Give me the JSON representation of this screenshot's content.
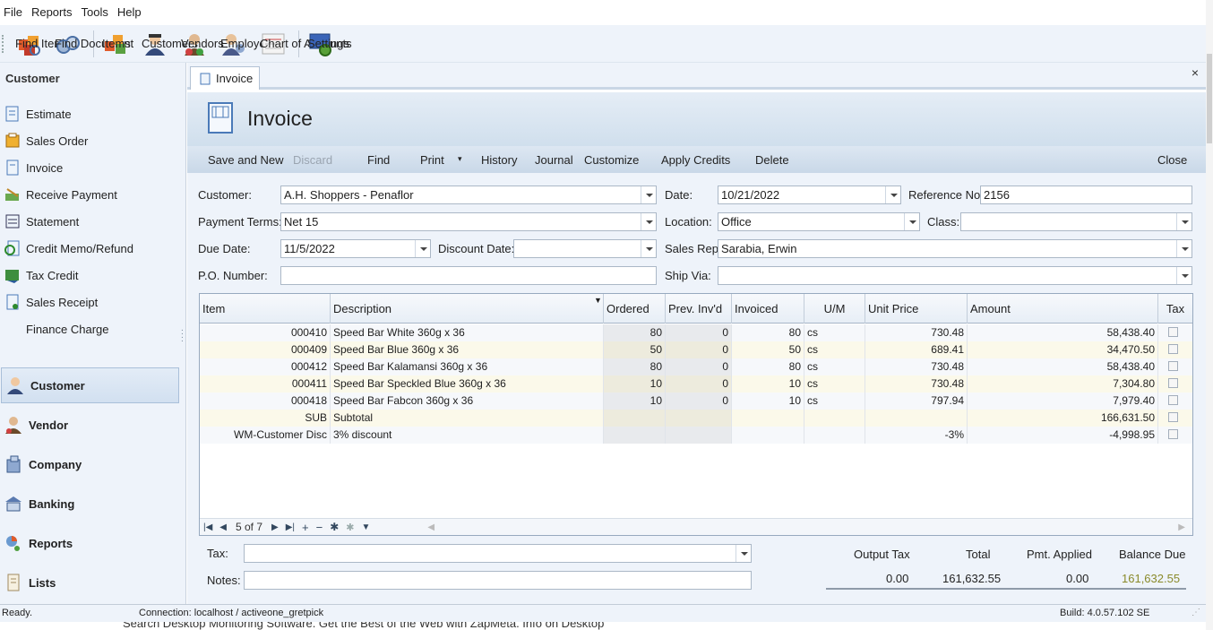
{
  "menu": {
    "items": [
      "File",
      "Reports",
      "Tools",
      "Help"
    ]
  },
  "toolbar": {
    "buttons": [
      {
        "label": "Find Item",
        "icon": "find-item-icon"
      },
      {
        "label": "Find Document",
        "icon": "find-document-icon"
      },
      {
        "label": "Items",
        "icon": "items-icon"
      },
      {
        "label": "Customers",
        "icon": "customers-icon"
      },
      {
        "label": "Vendors",
        "icon": "vendors-icon"
      },
      {
        "label": "Employees",
        "icon": "employees-icon"
      },
      {
        "label": "Chart of Accounts",
        "icon": "chart-of-accounts-icon"
      },
      {
        "label": "Settings",
        "icon": "settings-icon"
      }
    ]
  },
  "sidebar": {
    "header": "Customer",
    "items": [
      "Estimate",
      "Sales Order",
      "Invoice",
      "Receive Payment",
      "Statement",
      "Credit Memo/Refund",
      "Tax Credit",
      "Sales Receipt",
      "Finance Charge"
    ],
    "groups": [
      "Customer",
      "Vendor",
      "Company",
      "Banking",
      "Reports",
      "Lists"
    ],
    "selected_group": "Customer"
  },
  "tab": {
    "label": "Invoice",
    "close": "×"
  },
  "page_title": "Invoice",
  "actions": [
    "Save and New",
    "Discard",
    "Find",
    "Print",
    "History",
    "Journal",
    "Customize",
    "Apply Credits",
    "Delete",
    "Close"
  ],
  "form": {
    "customer_label": "Customer:",
    "customer": "A.H. Shoppers - Penaflor",
    "date_label": "Date:",
    "date": "10/21/2022",
    "ref_label": "Reference No:",
    "ref": "2156",
    "terms_label": "Payment Terms:",
    "terms": "Net 15",
    "location_label": "Location:",
    "location": "Office",
    "class_label": "Class:",
    "class": "",
    "due_label": "Due Date:",
    "due": "11/5/2022",
    "disc_label": "Discount Date:",
    "disc": "",
    "rep_label": "Sales Rep:",
    "rep": "Sarabia, Erwin",
    "po_label": "P.O. Number:",
    "po": "",
    "ship_label": "Ship Via:",
    "ship": ""
  },
  "grid": {
    "columns": [
      "Item",
      "Description",
      "Ordered",
      "Prev. Inv'd",
      "Invoiced",
      "U/M",
      "Unit Price",
      "Amount",
      "Tax"
    ],
    "rows": [
      [
        "000410",
        "Speed Bar White 360g x 36",
        "80",
        "0",
        "80",
        "cs",
        "730.48",
        "58,438.40"
      ],
      [
        "000409",
        "Speed Bar Blue 360g x 36",
        "50",
        "0",
        "50",
        "cs",
        "689.41",
        "34,470.50"
      ],
      [
        "000412",
        "Speed Bar Kalamansi 360g x 36",
        "80",
        "0",
        "80",
        "cs",
        "730.48",
        "58,438.40"
      ],
      [
        "000411",
        "Speed Bar Speckled Blue 360g x 36",
        "10",
        "0",
        "10",
        "cs",
        "730.48",
        "7,304.80"
      ],
      [
        "000418",
        "Speed Bar Fabcon 360g x 36",
        "10",
        "0",
        "10",
        "cs",
        "797.94",
        "7,979.40"
      ],
      [
        "SUB",
        "Subtotal",
        "",
        "",
        "",
        "",
        "",
        "166,631.50"
      ],
      [
        "WM-Customer Disc",
        "3% discount",
        "",
        "",
        "",
        "",
        "-3%",
        "-4,998.95"
      ]
    ],
    "pager": "5 of 7"
  },
  "footer": {
    "tax_label": "Tax:",
    "tax": "",
    "notes_label": "Notes:",
    "notes": "",
    "totals_headers": [
      "Output Tax",
      "Total",
      "Pmt. Applied",
      "Balance Due"
    ],
    "totals_values": [
      "0.00",
      "161,632.55",
      "0.00",
      "161,632.55"
    ],
    "balance_color": "#8a8a2a"
  },
  "status": {
    "ready": "Ready.",
    "connection": "Connection: localhost / activeone_gretpick",
    "build": "Build: 4.0.57.102 SE"
  },
  "below_text": "Search Desktop Monitoring Software. Get the Best of the Web with ZapMeta. Info on Desktop"
}
